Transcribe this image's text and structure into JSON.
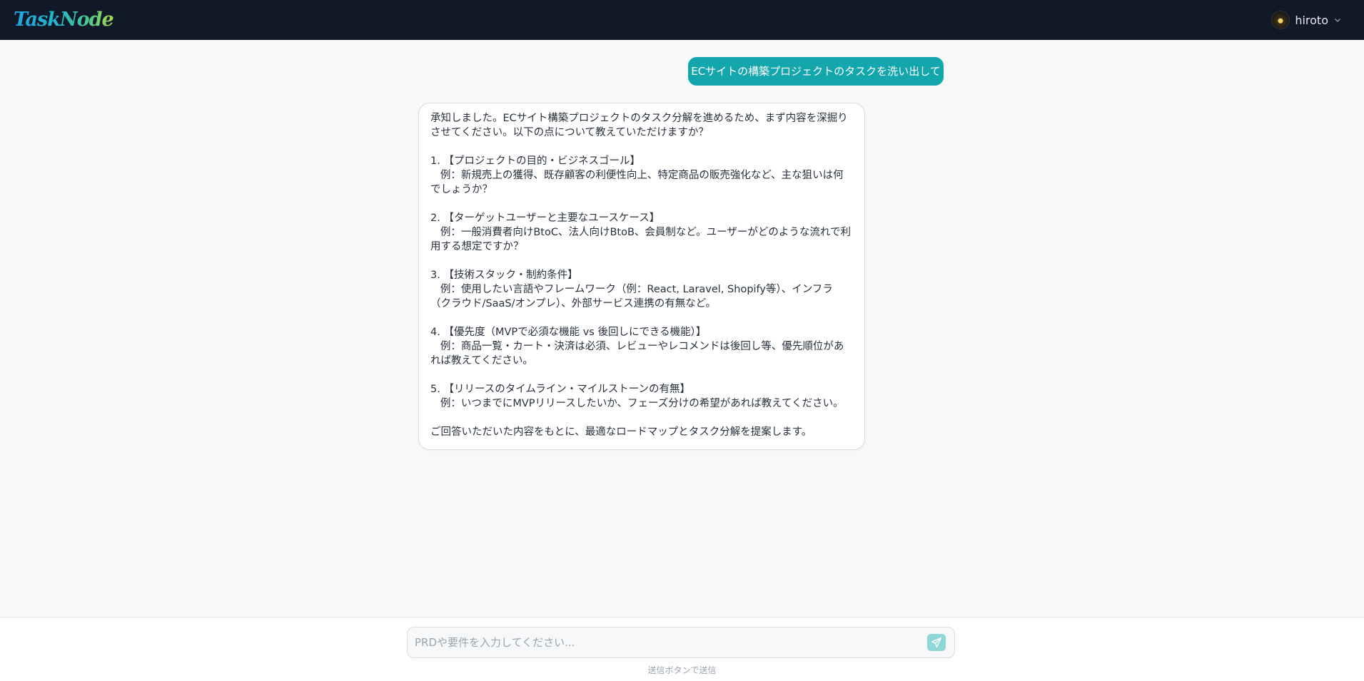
{
  "app": {
    "logo_text": "TaskNode"
  },
  "header": {
    "username": "hiroto"
  },
  "chat": {
    "messages": [
      {
        "role": "user",
        "text": "ECサイトの構築プロジェクトのタスクを洗い出して"
      },
      {
        "role": "assistant",
        "text": "承知しました。ECサイト構築プロジェクトのタスク分解を進めるため、まず内容を深掘りさせてください。以下の点について教えていただけますか？\n\n1. 【プロジェクトの目的・ビジネスゴール】\n   例：新規売上の獲得、既存顧客の利便性向上、特定商品の販売強化など、主な狙いは何でしょうか？\n\n2. 【ターゲットユーザーと主要なユースケース】\n   例：一般消費者向けBtoC、法人向けBtoB、会員制など。ユーザーがどのような流れで利用する想定ですか？\n\n3. 【技術スタック・制約条件】\n   例：使用したい言語やフレームワーク（例：React, Laravel, Shopify等）、インフラ（クラウド/SaaS/オンプレ）、外部サービス連携の有無など。\n\n4. 【優先度（MVPで必須な機能 vs 後回しにできる機能）】\n   例：商品一覧・カート・決済は必須、レビューやレコメンドは後回し等、優先順位があれば教えてください。\n\n5. 【リリースのタイムライン・マイルストーンの有無】\n   例：いつまでにMVPリリースしたいか、フェーズ分けの希望があれば教えてください。\n\nご回答いただいた内容をもとに、最適なロードマップとタスク分解を提案します。"
      }
    ]
  },
  "composer": {
    "placeholder": "PRDや要件を入力してください...",
    "value": "",
    "hint": "送信ボタンで送信"
  },
  "colors": {
    "header_bg": "#111827",
    "accent": "#14a6ad",
    "send_button": "#8fd6d6",
    "page_bg": "#f6f8fa"
  }
}
